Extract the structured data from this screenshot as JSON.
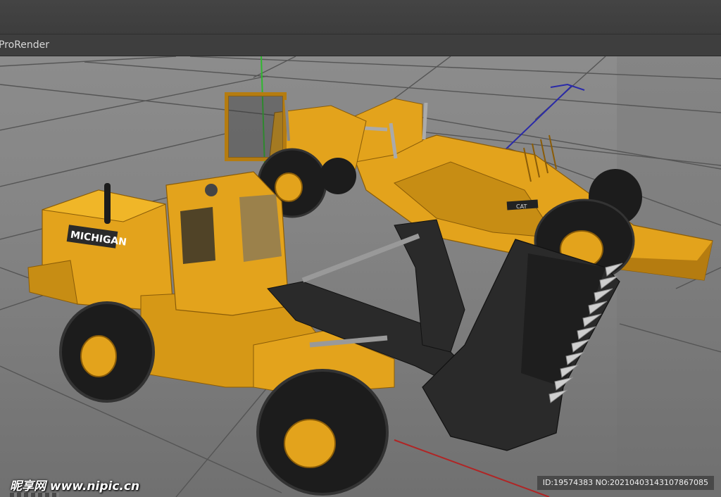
{
  "viewport": {
    "header_label": "ProRender"
  },
  "models": {
    "loader_brand": "MICHIGAN",
    "scraper_badge": "CAT"
  },
  "watermark": {
    "site_text": "昵享网 www.nipic.cn",
    "id_text": "ID:19574383 NO:20210403143107867085"
  },
  "colors": {
    "machine_yellow": "#e3a31c",
    "machine_dark": "#b57c10",
    "bucket_black": "#2a2a2a",
    "tire_black": "#1c1c1c",
    "grid_line": "#5a5a5a",
    "axis_green": "#2fb82f",
    "axis_blue": "#2a2aa8",
    "axis_red": "#b02525"
  }
}
